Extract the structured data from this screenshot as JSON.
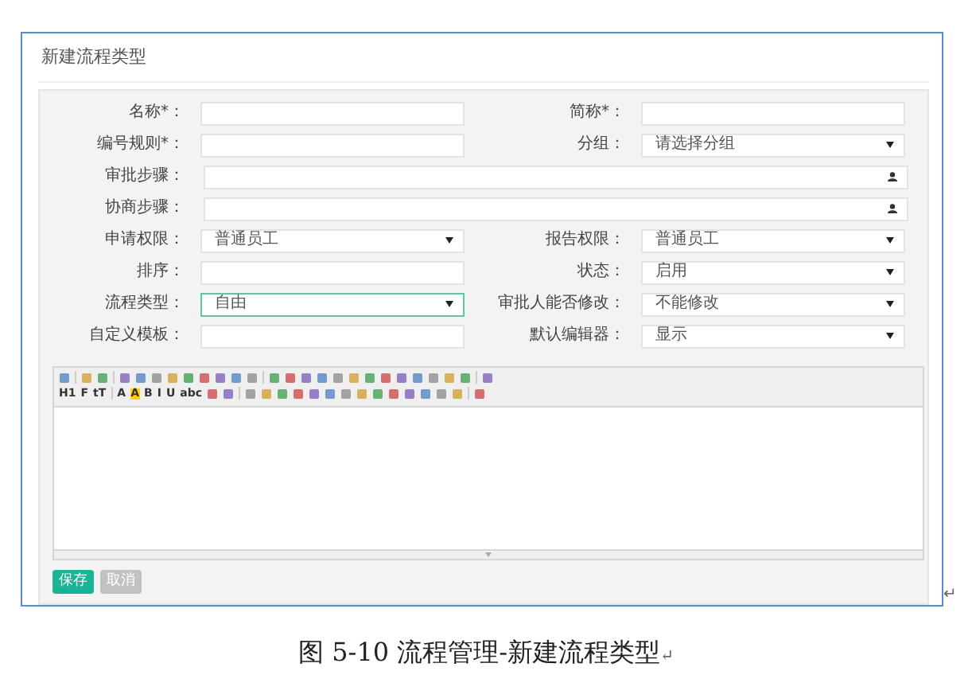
{
  "window": {
    "title": "新建流程类型"
  },
  "form": {
    "rows": [
      {
        "kind": "pair",
        "fields": [
          {
            "label": "名称*：",
            "kind": "text",
            "focused": false
          },
          {
            "label": "简称*：",
            "kind": "text",
            "focused": false
          }
        ]
      },
      {
        "kind": "pair",
        "fields": [
          {
            "label": "编号规则*：",
            "kind": "text",
            "focused": false
          },
          {
            "label": "分组：",
            "kind": "select",
            "value": "请选择分组",
            "focused": false
          }
        ]
      },
      {
        "kind": "wide",
        "fields": [
          {
            "label": "审批步骤：",
            "kind": "picker",
            "focused": false
          }
        ]
      },
      {
        "kind": "wide",
        "fields": [
          {
            "label": "协商步骤：",
            "kind": "picker",
            "focused": false
          }
        ]
      },
      {
        "kind": "pair",
        "fields": [
          {
            "label": "申请权限：",
            "kind": "select",
            "value": "普通员工",
            "focused": false
          },
          {
            "label": "报告权限：",
            "kind": "select",
            "value": "普通员工",
            "focused": false
          }
        ]
      },
      {
        "kind": "pair",
        "fields": [
          {
            "label": "排序：",
            "kind": "text",
            "focused": false
          },
          {
            "label": "状态：",
            "kind": "select",
            "value": "启用",
            "focused": false
          }
        ]
      },
      {
        "kind": "pair",
        "fields": [
          {
            "label": "流程类型：",
            "kind": "select",
            "value": "自由",
            "focused": true
          },
          {
            "label": "审批人能否修改：",
            "kind": "select",
            "value": "不能修改",
            "focused": false
          }
        ]
      },
      {
        "kind": "pair",
        "fields": [
          {
            "label": "自定义模板：",
            "kind": "text",
            "focused": false
          },
          {
            "label": "默认编辑器：",
            "kind": "select",
            "value": "显示",
            "focused": false
          }
        ]
      }
    ]
  },
  "editor": {
    "toolbar": [
      [
        {
          "kind": "icon"
        },
        {
          "kind": "sep"
        },
        {
          "kind": "icon"
        },
        {
          "kind": "icon"
        },
        {
          "kind": "sep"
        },
        {
          "kind": "icon"
        },
        {
          "kind": "icon"
        },
        {
          "kind": "icon"
        },
        {
          "kind": "icon"
        },
        {
          "kind": "icon"
        },
        {
          "kind": "icon"
        },
        {
          "kind": "icon"
        },
        {
          "kind": "icon"
        },
        {
          "kind": "icon"
        },
        {
          "kind": "sep"
        },
        {
          "kind": "icon"
        },
        {
          "kind": "icon"
        },
        {
          "kind": "icon"
        },
        {
          "kind": "icon"
        },
        {
          "kind": "icon"
        },
        {
          "kind": "icon"
        },
        {
          "kind": "icon"
        },
        {
          "kind": "icon"
        },
        {
          "kind": "icon"
        },
        {
          "kind": "icon"
        },
        {
          "kind": "icon"
        },
        {
          "kind": "icon"
        },
        {
          "kind": "icon"
        },
        {
          "kind": "sep"
        },
        {
          "kind": "icon"
        }
      ],
      [
        {
          "kind": "text",
          "text": "H1"
        },
        {
          "kind": "text",
          "text": "F"
        },
        {
          "kind": "text",
          "text": "tT"
        },
        {
          "kind": "sep"
        },
        {
          "kind": "text",
          "text": "A"
        },
        {
          "kind": "highlight",
          "text": "A"
        },
        {
          "kind": "text",
          "text": "B"
        },
        {
          "kind": "text",
          "text": "I"
        },
        {
          "kind": "text",
          "text": "U"
        },
        {
          "kind": "text",
          "text": "abc"
        },
        {
          "kind": "icon"
        },
        {
          "kind": "icon"
        },
        {
          "kind": "sep"
        },
        {
          "kind": "icon"
        },
        {
          "kind": "icon"
        },
        {
          "kind": "icon"
        },
        {
          "kind": "icon"
        },
        {
          "kind": "icon"
        },
        {
          "kind": "icon"
        },
        {
          "kind": "icon"
        },
        {
          "kind": "icon"
        },
        {
          "kind": "icon"
        },
        {
          "kind": "icon"
        },
        {
          "kind": "icon"
        },
        {
          "kind": "icon"
        },
        {
          "kind": "icon"
        },
        {
          "kind": "icon"
        },
        {
          "kind": "sep"
        },
        {
          "kind": "icon"
        }
      ]
    ]
  },
  "buttons": [
    {
      "label": "保存",
      "disabled": false
    },
    {
      "label": "取消",
      "disabled": true
    }
  ],
  "caption": {
    "text": "图 5-10 流程管理-新建流程类型",
    "mark": "↵"
  },
  "frame_mark": "↵"
}
